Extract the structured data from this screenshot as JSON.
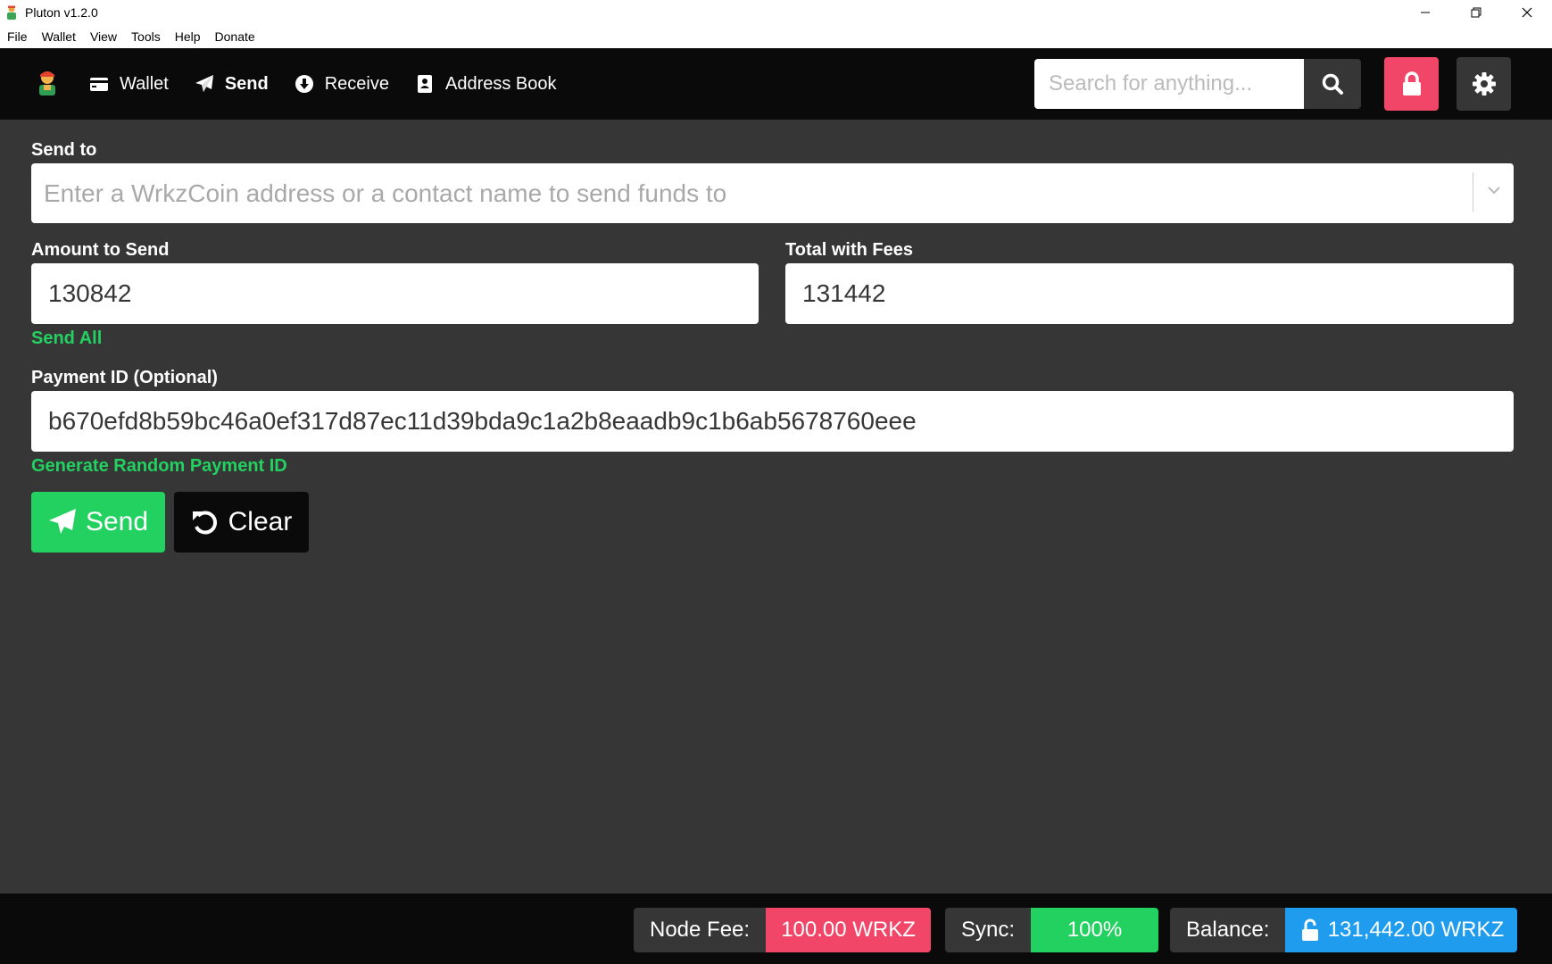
{
  "window": {
    "title": "Pluton v1.2.0"
  },
  "menu": [
    "File",
    "Wallet",
    "View",
    "Tools",
    "Help",
    "Donate"
  ],
  "nav": {
    "items": [
      {
        "label": "Wallet",
        "icon": "wallet-icon"
      },
      {
        "label": "Send",
        "icon": "paper-plane-icon",
        "active": true
      },
      {
        "label": "Receive",
        "icon": "arrow-circle-down-icon"
      },
      {
        "label": "Address Book",
        "icon": "address-book-icon"
      }
    ],
    "search_placeholder": "Search for anything..."
  },
  "form": {
    "send_to_label": "Send to",
    "send_to_placeholder": "Enter a WrkzCoin address or a contact name to send funds to",
    "amount_label": "Amount to Send",
    "amount_value": "130842",
    "total_label": "Total with Fees",
    "total_value": "131442",
    "send_all_label": "Send All",
    "payment_id_label": "Payment ID (Optional)",
    "payment_id_value": "b670efd8b59bc46a0ef317d87ec11d39bda9c1a2b8eaadb9c1b6ab5678760eee",
    "generate_payment_id_label": "Generate Random Payment ID",
    "send_button": "Send",
    "clear_button": "Clear"
  },
  "footer": {
    "node_fee_label": "Node Fee:",
    "node_fee_value": "100.00 WRKZ",
    "sync_label": "Sync:",
    "sync_value": "100%",
    "balance_label": "Balance:",
    "balance_value": "131,442.00 WRKZ"
  },
  "colors": {
    "primary": "#23d160",
    "danger": "#f14668",
    "info": "#209cee",
    "dark": "#0a0a0a",
    "background": "#363636"
  }
}
